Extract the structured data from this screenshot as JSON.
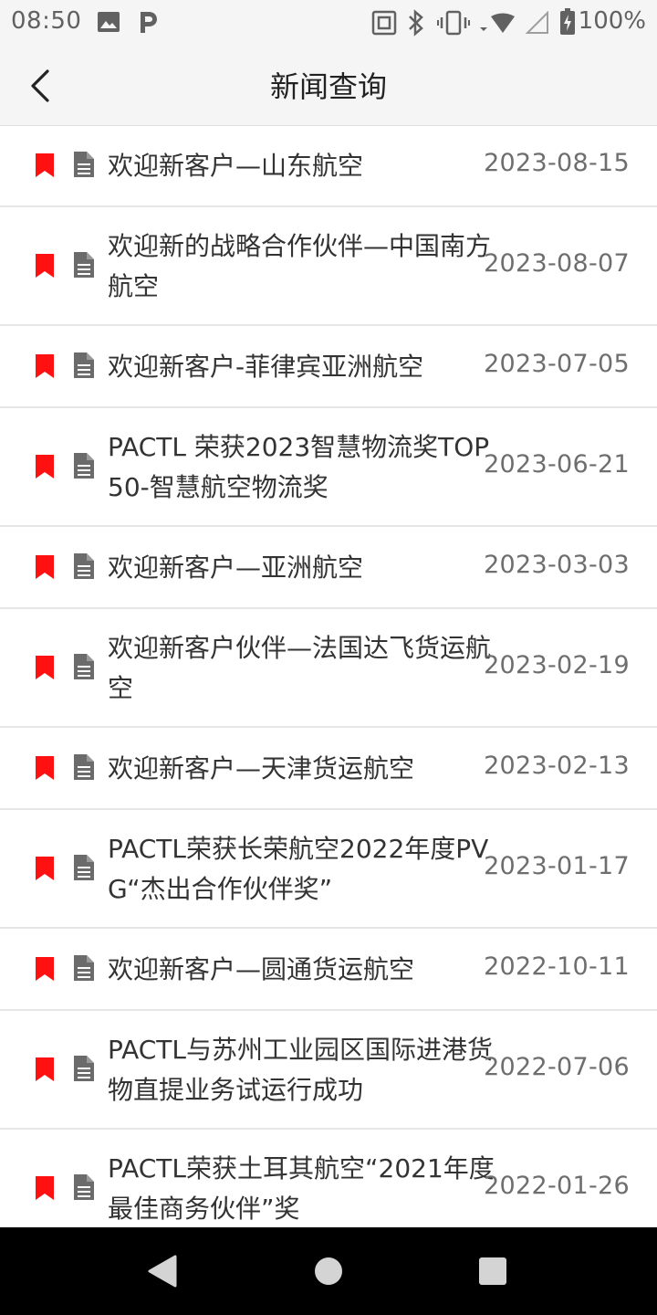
{
  "status_bar": {
    "time": "08:50",
    "battery": "100%",
    "icons": [
      "image-icon",
      "p-icon",
      "nfc-icon",
      "bluetooth-icon",
      "vibrate-icon",
      "wifi-icon",
      "signal-icon",
      "battery-icon"
    ]
  },
  "app_bar": {
    "title": "新闻查询",
    "back_icon": "chevron-left-icon"
  },
  "news": [
    {
      "title": "欢迎新客户—山东航空",
      "date": "2023-08-15"
    },
    {
      "title": "欢迎新的战略合作伙伴—中国南方航空",
      "date": "2023-08-07"
    },
    {
      "title": "欢迎新客户-菲律宾亚洲航空",
      "date": "2023-07-05"
    },
    {
      "title": "PACTL 荣获2023智慧物流奖TOP50-智慧航空物流奖",
      "date": "2023-06-21"
    },
    {
      "title": "欢迎新客户—亚洲航空",
      "date": "2023-03-03"
    },
    {
      "title": "欢迎新客户伙伴—法国达飞货运航空",
      "date": "2023-02-19"
    },
    {
      "title": "欢迎新客户—天津货运航空",
      "date": "2023-02-13"
    },
    {
      "title": "PACTL荣获长荣航空2022年度PVG“杰出合作伙伴奖”",
      "date": "2023-01-17"
    },
    {
      "title": "欢迎新客户—圆通货运航空",
      "date": "2022-10-11"
    },
    {
      "title": "PACTL与苏州工业园区国际进港货物直提业务试运行成功",
      "date": "2022-07-06"
    },
    {
      "title": "PACTL荣获土耳其航空“2021年度最佳商务伙伴”奖",
      "date": "2022-01-26"
    }
  ],
  "colors": {
    "bookmark": "#ff1111",
    "doc_icon": "#6b6b6b",
    "title_text": "#333333",
    "date_text": "#6e6e6e",
    "bar_bg": "#f5f5f5"
  },
  "nav_bar": {
    "buttons": [
      "back-triangle-icon",
      "home-circle-icon",
      "recents-square-icon"
    ]
  }
}
